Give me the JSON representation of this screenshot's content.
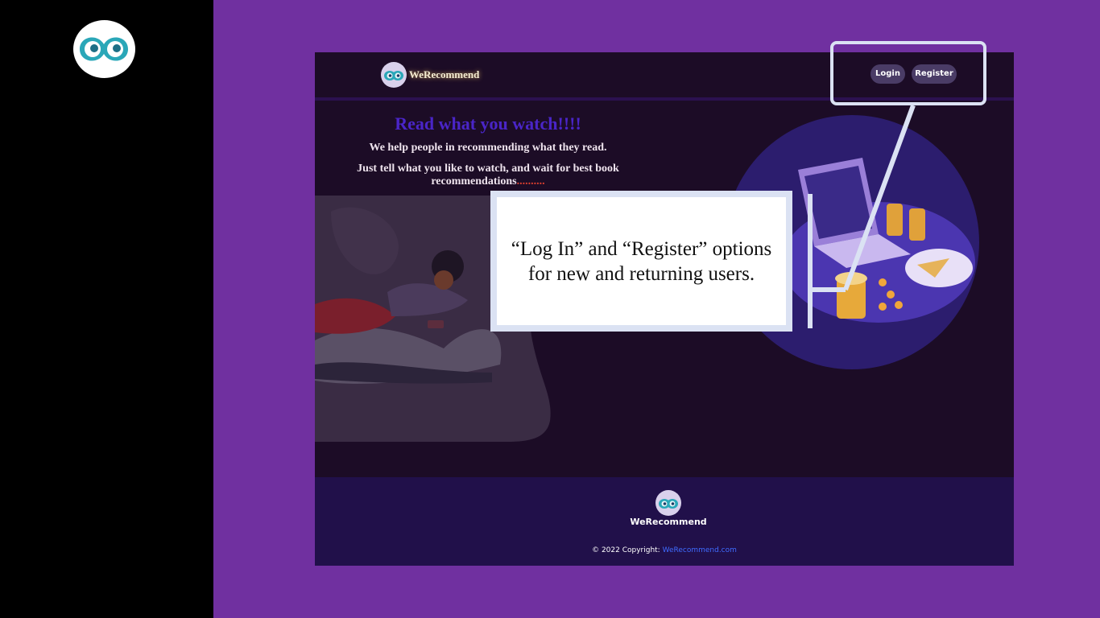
{
  "app": {
    "brand": "WeRecommend",
    "icon": "owl-eyes-logo"
  },
  "nav": {
    "login_label": "Login",
    "register_label": "Register"
  },
  "hero": {
    "title": "Read what you watch!!!!",
    "subtitle": "We help people in recommending what they read.",
    "description": "Just tell what you like to watch, and wait for best book recommendations",
    "dots": ".........."
  },
  "footer": {
    "brand": "WeRecommend",
    "copyright_prefix": "© 2022 Copyright: ",
    "copyright_link": "WeRecommend.com"
  },
  "callout": {
    "text": "“Log In” and “Register” options for new and returning users."
  },
  "colors": {
    "slide_background": "#7030a0",
    "site_background": "#1c0c26",
    "footer_background": "#21104a",
    "hero_title": "#4a25c8",
    "link": "#3f6bff",
    "callout_border": "#dbe2f3"
  },
  "icons": [
    "owl-eyes-logo",
    "reading-woman-illustration",
    "laptop-snacks-illustration"
  ]
}
